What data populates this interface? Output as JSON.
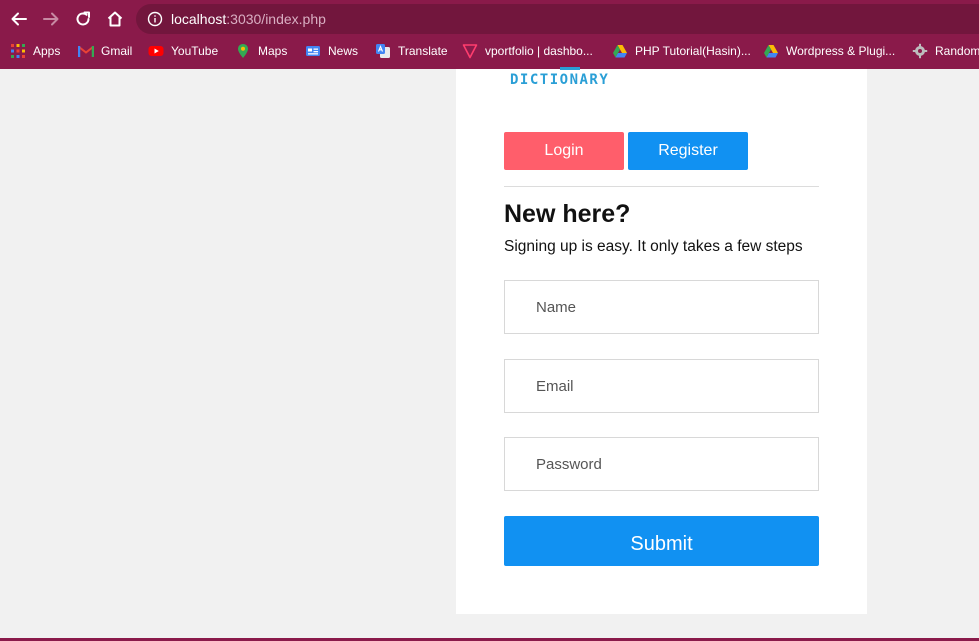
{
  "browser": {
    "url_host": "localhost",
    "url_path": ":3030/index.php",
    "colors": {
      "frame": "#8a1a4a",
      "omnibox": "#72163d"
    }
  },
  "bookmarks": [
    {
      "label": "Apps",
      "icon": "apps-grid-icon"
    },
    {
      "label": "Gmail",
      "icon": "gmail-icon"
    },
    {
      "label": "YouTube",
      "icon": "youtube-icon"
    },
    {
      "label": "Maps",
      "icon": "maps-pin-icon"
    },
    {
      "label": "News",
      "icon": "news-icon"
    },
    {
      "label": "Translate",
      "icon": "translate-icon"
    },
    {
      "label": "vportfolio | dashbo...",
      "icon": "triangle-icon"
    },
    {
      "label": "PHP Tutorial(Hasin)...",
      "icon": "drive-icon"
    },
    {
      "label": "Wordpress & Plugi...",
      "icon": "drive-icon"
    },
    {
      "label": "Random",
      "icon": "gear-icon"
    }
  ],
  "page": {
    "logo_text": "DICTIONARY",
    "tabs": {
      "login": "Login",
      "register": "Register"
    },
    "heading": "New here?",
    "subtext": "Signing up is easy. It only takes a few steps",
    "fields": {
      "name": "Name",
      "email": "Email",
      "password": "Password"
    },
    "submit": "Submit",
    "colors": {
      "login": "#ff5e6b",
      "register": "#1191f2",
      "submit": "#1191f2"
    }
  }
}
